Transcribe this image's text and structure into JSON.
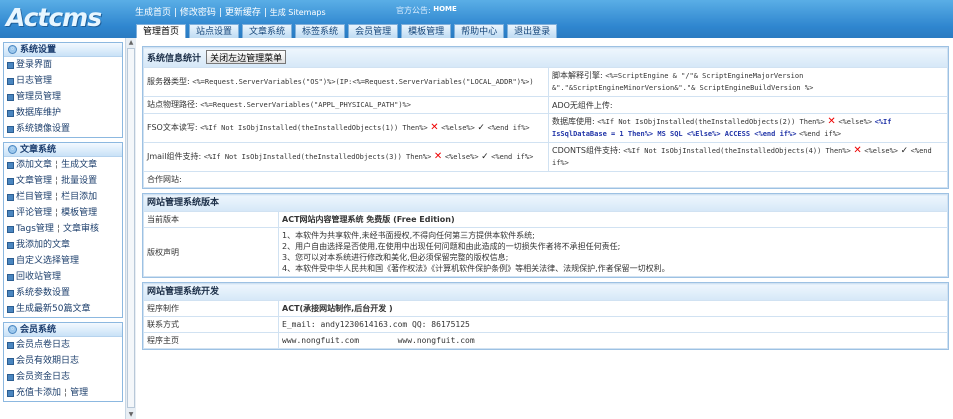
{
  "logo": "Actcms",
  "top": {
    "links": [
      "生成首页",
      "修改密码",
      "更新缓存"
    ],
    "generate": "生成 Sitemaps",
    "notice_label": "官方公告:",
    "notice_value": "HOME"
  },
  "tabs": [
    "管理首页",
    "站点设置",
    "文章系统",
    "标签系统",
    "会员管理",
    "模板管理",
    "帮助中心",
    "退出登录"
  ],
  "sidebar": {
    "sections": [
      {
        "title": "系统设置",
        "items": [
          "登录界面",
          "日志管理",
          "管理员管理",
          "数据库维护",
          "系统镜像设置"
        ]
      },
      {
        "title": "文章系统",
        "items": [
          [
            "添加文章",
            "生成文章"
          ],
          [
            "文章管理",
            "批量设置"
          ],
          [
            "栏目管理",
            "栏目添加"
          ],
          [
            "评论管理",
            "模板管理"
          ],
          [
            "Tags管理",
            "文章审核"
          ],
          [
            "我添加的文章"
          ],
          [
            "自定义选择管理"
          ],
          [
            "回收站管理"
          ],
          [
            "系统参数设置"
          ],
          [
            "生成最新50篇文章"
          ]
        ]
      },
      {
        "title": "会员系统",
        "items": [
          [
            "会员点卷日志"
          ],
          [
            "会员有效期日志"
          ],
          [
            "会员资金日志"
          ],
          [
            "充值卡添加",
            "管理"
          ]
        ]
      }
    ]
  },
  "sysinfo": {
    "title": "系统信息统计",
    "close_button": "关闭左边管理菜单",
    "server_type_label": "服务器类型:",
    "server_type_value": "<%=Request.ServerVariables(\"OS\")%>(IP:<%=Request.ServerVariables(\"LOCAL_ADDR\")%>)",
    "script_engine_label": "脚本解释引擎:",
    "script_engine_value": "<%=ScriptEngine & \"/\"& ScriptEngineMajorVersion &\".\"&ScriptEngineMinorVersion&\".\"& ScriptEngineBuildVersion %>",
    "path_label": "站点物理路径:",
    "path_value": "<%=Request.ServerVariables(\"APPL_PHYSICAL_PATH\")%>",
    "ado_label": "ADO无组件上传:",
    "fso_label": "FSO文本读写:",
    "fso_value_a": "<%If Not IsObjInstalled(theInstalledObjects(1)) Then%>",
    "fso_value_b": "<%else%>",
    "fso_value_c": "<%end if%>",
    "db_label": "数据库使用:",
    "db_value_a": "<%If Not IsObjInstalled(theInstalledObjects(2)) Then%>",
    "db_value_b": "<%else%>",
    "db_value_c": "<%If IsSqlDataBase = 1 Then%> MS SQL <%Else%> ACCESS <%end if%>",
    "db_value_d": "<%end if%>",
    "jmail_label": "Jmail组件支持:",
    "jmail_value_a": "<%If Not IsObjInstalled(theInstalledObjects(3)) Then%>",
    "jmail_value_b": "<%else%>",
    "jmail_value_c": "<%end if%>",
    "cdonts_label": "CDONTS组件支持:",
    "cdonts_value_a": "<%If Not IsObjInstalled(theInstalledObjects(4)) Then%>",
    "cdonts_value_b": "<%else%>",
    "cdonts_value_c": "<%end if%>",
    "partner_label": "合作网站:"
  },
  "version": {
    "title": "网站管理系统版本",
    "current_label": "当前版本",
    "current_value": "ACT网站内容管理系统 免费版 (Free Edition)",
    "copyright_label": "版权声明",
    "copyright_lines": [
      "1、本软件为共享软件,未经书面授权,不得向任何第三方提供本软件系统;",
      "2、用户自由选择是否使用,在使用中出现任何问题和由此造成的一切损失作者将不承担任何责任;",
      "3、您可以对本系统进行修改和美化,但必须保留完整的版权信息;",
      "4、本软件受中华人民共和国《著作权法》《计算机软件保护条例》等相关法律、法规保护,作者保留一切权利。"
    ]
  },
  "dev": {
    "title": "网站管理系统开发",
    "maker_label": "程序制作",
    "maker_value": "ACT(承接网站制作,后台开发 )",
    "contact_label": "联系方式",
    "contact_value": "E_mail: andy1230614163.com QQ: 86175125",
    "home_label": "程序主页",
    "home_value_a": "www.nongfuit.com",
    "home_value_b": "www.nongfuit.com"
  }
}
